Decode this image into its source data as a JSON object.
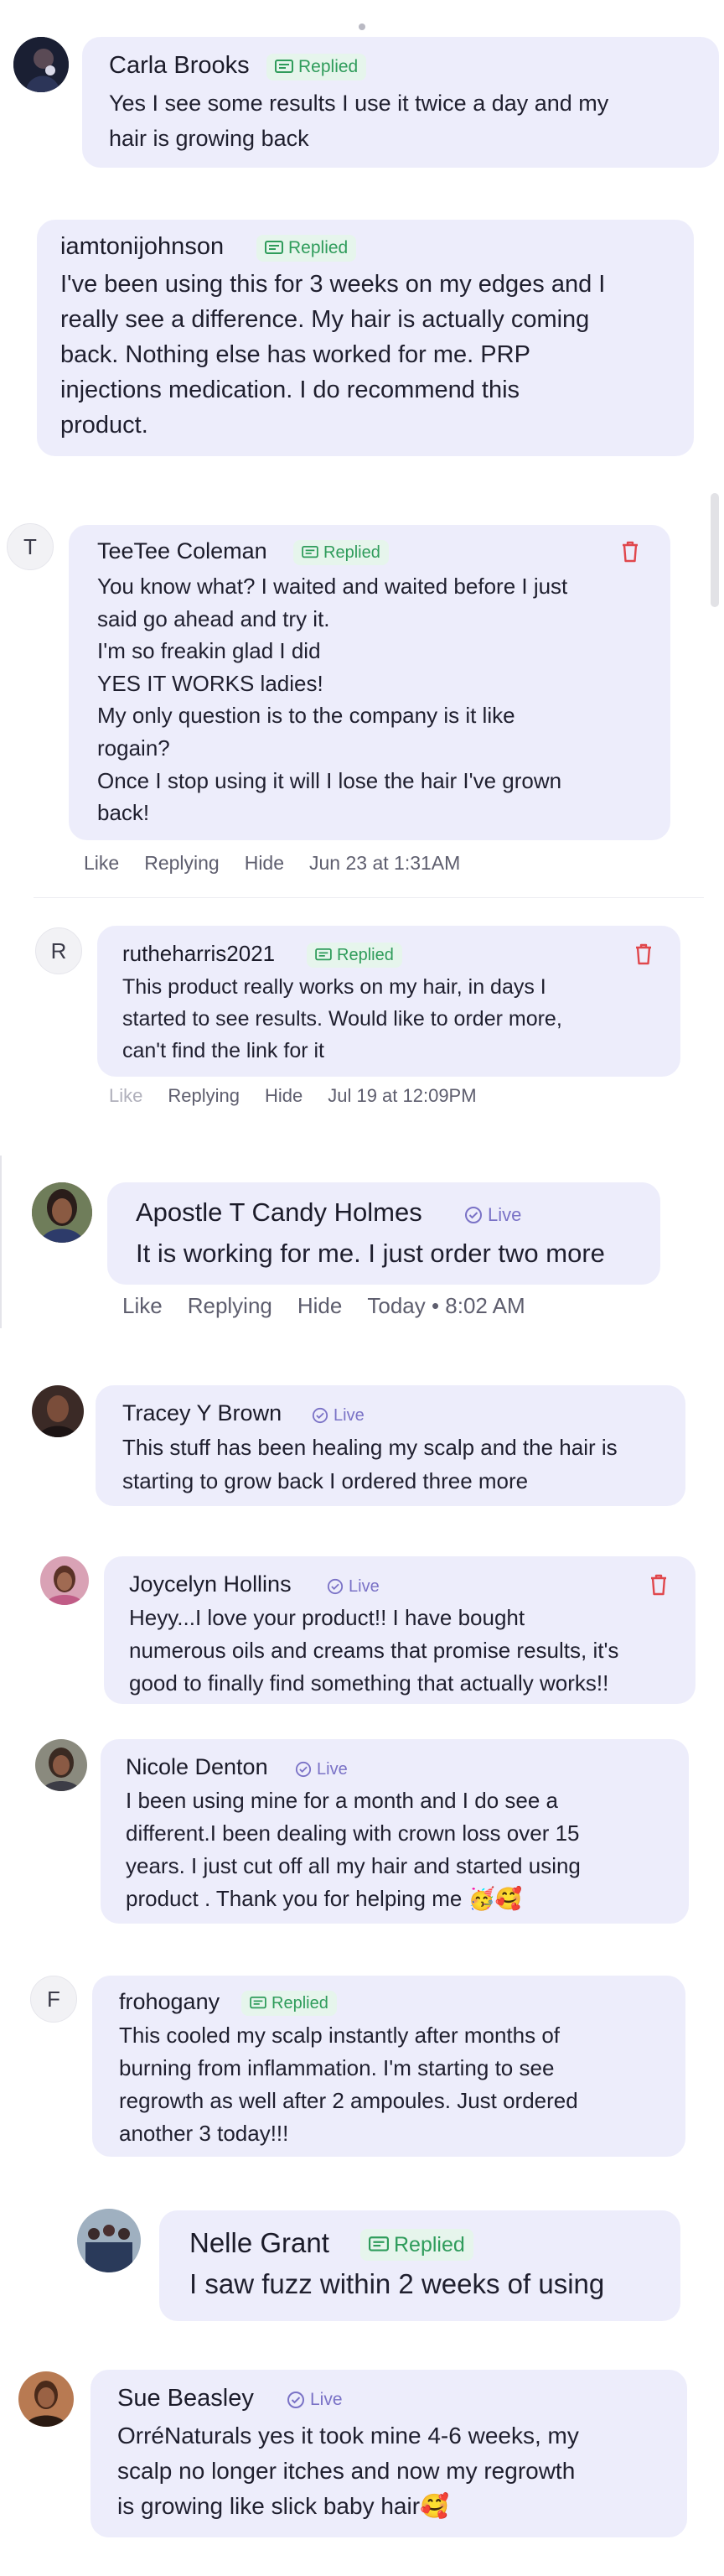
{
  "comments": [
    {
      "name": "Carla Brooks",
      "status": "Replied",
      "text": "Yes I see some results I use it twice a day and my\nhair is growing back",
      "avatar_icon": "user-photo"
    },
    {
      "name": "iamtonijohnson",
      "status": "Replied",
      "text": "I've been using this for 3 weeks on my edges and I\nreally see a difference. My hair is actually coming\nback. Nothing else has worked for me. PRP\ninjections medication. I do recommend this\nproduct."
    },
    {
      "name": "TeeTee Coleman",
      "status": "Replied",
      "avatar_letter": "T",
      "text": "You know what? I waited and waited before I just\nsaid go ahead and try it.\nI'm so freakin glad I did\nYES IT WORKS ladies!\nMy only question is to the company is it like\nrogain?\nOnce I stop using it will I lose the hair I've grown\nback!",
      "actions": {
        "like": "Like",
        "reply": "Replying",
        "hide": "Hide",
        "time": "Jun 23 at 1:31AM"
      }
    },
    {
      "name": "rutheharris2021",
      "status": "Replied",
      "avatar_letter": "R",
      "text": "This product really works on my hair, in days I\nstarted to see results. Would like to order more,\ncan't find the link for it",
      "actions": {
        "like": "Like",
        "reply": "Replying",
        "hide": "Hide",
        "time": "Jul 19 at 12:09PM"
      }
    },
    {
      "name": "Apostle T Candy Holmes",
      "status": "Live",
      "text": "It is working for me. I just order two more",
      "actions": {
        "like": "Like",
        "reply": "Replying",
        "hide": "Hide",
        "time": "Today • 8:02 AM"
      }
    },
    {
      "name": "Tracey Y Brown",
      "status": "Live",
      "text": "This stuff has been healing my scalp and the hair is\nstarting to grow back I ordered three more"
    },
    {
      "name": "Joycelyn Hollins",
      "status": "Live",
      "text": "Heyy...I love your product!! I have bought\nnumerous oils and creams that promise results, it's\ngood to finally find something that actually works!!"
    },
    {
      "name": "Nicole Denton",
      "status": "Live",
      "text": "I been using mine for a month and I do see a\ndifferent.I been dealing with crown loss over 15\nyears. I just cut off all my hair and started using\nproduct . Thank you for helping me 🥳🥰"
    },
    {
      "name": "frohogany",
      "status": "Replied",
      "avatar_letter": "F",
      "text": "This cooled my scalp instantly after months of\nburning from inflammation. I'm starting to see\nregrowth as well after 2 ampoules. Just ordered\nanother 3 today!!!"
    },
    {
      "name": "Nelle Grant",
      "status": "Replied",
      "text": "I saw fuzz within 2 weeks of using"
    },
    {
      "name": "Sue Beasley",
      "status": "Live",
      "text": "OrréNaturals yes it took mine 4-6 weeks, my\nscalp no longer itches and now my regrowth\nis growing like slick baby hair🥰"
    }
  ],
  "colors": {
    "bubble": "#ededfb",
    "replied_badge_bg": "#e6f5ec",
    "replied_badge_text": "#2f9c5b",
    "live_text": "#7a72c6",
    "delete_icon": "#e0474c"
  }
}
